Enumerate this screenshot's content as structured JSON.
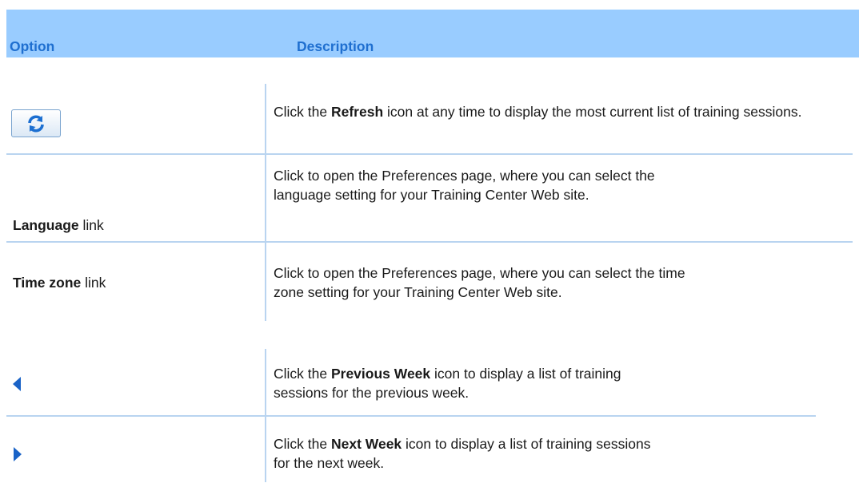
{
  "header": {
    "option_label": "Option",
    "description_label": "Description"
  },
  "rows": [
    {
      "option_icon": "refresh-icon",
      "desc_pre": "Click the ",
      "desc_bold": "Refresh",
      "desc_rest": " icon at any time to display the most current list of training sessions."
    },
    {
      "option_bold": "Language",
      "option_rest": " link",
      "desc_line1": "Click to open the Preferences page, where you can select the",
      "desc_line2": "language setting for your Training Center Web site."
    },
    {
      "option_bold": "Time zone",
      "option_rest": " link",
      "desc_line1": "Click to open the Preferences page, where you can select the time",
      "desc_line2": "zone setting for your Training Center Web site."
    },
    {
      "option_icon": "previous-week-icon",
      "desc_pre": "Click the ",
      "desc_bold": "Previous Week",
      "desc_rest": " icon to display a list of training",
      "desc_line2": "sessions for the previous week."
    },
    {
      "option_icon": "next-week-icon",
      "desc_pre": "Click the ",
      "desc_bold": "Next Week",
      "desc_rest": " icon to display a list of training sessions",
      "desc_line2": "for the next week."
    }
  ],
  "colors": {
    "header_bg": "#99ccff",
    "header_text": "#1f6fd0",
    "divider": "#b9d4f0",
    "arrow": "#1a63c7"
  }
}
